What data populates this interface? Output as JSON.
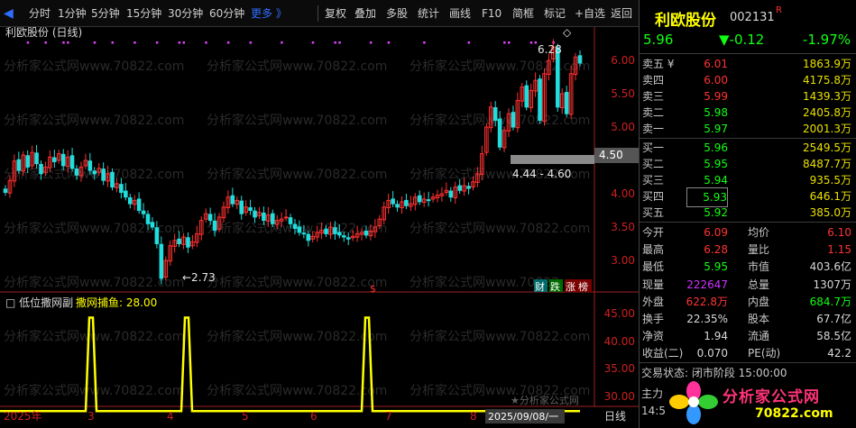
{
  "toolbar": {
    "periods": [
      "分时",
      "1分钟",
      "5分钟",
      "15分钟",
      "30分钟",
      "60分钟"
    ],
    "more": "更多 》",
    "actions": [
      "复权",
      "叠加",
      "多股",
      "统计",
      "画线",
      "F10",
      "简框",
      "标记",
      "+自选",
      "返回"
    ]
  },
  "main_chart": {
    "title": "利欧股份 (日线)",
    "max_label": "6.28",
    "min_label": "←2.73",
    "range_label": "4.44 - 4.60",
    "price_marker": "4.50",
    "y_ticks": [
      "6.00",
      "5.50",
      "5.00",
      "4.50",
      "4.00",
      "3.50",
      "3.00"
    ],
    "badges": [
      "财",
      "跌",
      "涨",
      "榜"
    ],
    "dollar": "$"
  },
  "indicator": {
    "title": "低位撒网副",
    "series_label": "撒网捕鱼: 28.00",
    "y_ticks": [
      "45.00",
      "40.00",
      "35.00",
      "30.00"
    ],
    "watermark": "★分析家公式网"
  },
  "x_axis": {
    "labels": [
      "2025年",
      "3",
      "4",
      "5",
      "6",
      "7",
      "8",
      "2025/09/08/一"
    ],
    "unit": "日线"
  },
  "watermark_text": "分析家公式网www.70822.com",
  "chart_data": [
    {
      "type": "candlestick",
      "title": "利欧股份 (日线)",
      "ylim": [
        2.5,
        6.5
      ],
      "y_ticks": [
        3.0,
        3.5,
        4.0,
        4.5,
        5.0,
        5.5,
        6.0
      ],
      "annotations": {
        "max": 6.28,
        "min": 2.73,
        "range": "4.44 - 4.60",
        "current_marker": 4.5
      },
      "close": [
        4.02,
        4.2,
        4.49,
        4.35,
        4.58,
        4.4,
        4.62,
        4.45,
        4.3,
        4.4,
        4.55,
        4.48,
        4.6,
        4.42,
        4.55,
        4.38,
        4.28,
        4.4,
        4.5,
        4.35,
        4.3,
        4.38,
        4.2,
        4.3,
        4.1,
        4.15,
        4.02,
        3.95,
        3.85,
        3.9,
        3.75,
        3.7,
        3.55,
        3.5,
        3.25,
        2.73,
        3.0,
        3.22,
        3.3,
        3.25,
        3.35,
        3.2,
        3.28,
        3.4,
        3.6,
        3.7,
        3.6,
        3.45,
        3.65,
        3.8,
        3.95,
        3.85,
        3.9,
        3.7,
        3.8,
        3.75,
        3.65,
        3.72,
        3.6,
        3.68,
        3.55,
        3.6,
        3.62,
        3.65,
        3.55,
        3.48,
        3.42,
        3.4,
        3.3,
        3.36,
        3.42,
        3.45,
        3.4,
        3.5,
        3.4,
        3.38,
        3.35,
        3.32,
        3.36,
        3.4,
        3.42,
        3.38,
        3.44,
        3.5,
        3.62,
        3.8,
        3.9,
        3.85,
        3.8,
        3.88,
        3.82,
        3.85,
        3.95,
        3.88,
        3.92,
        3.9,
        3.95,
        3.98,
        4.0,
        4.05,
        3.95,
        4.1,
        4.05,
        4.12,
        4.08,
        4.18,
        4.3,
        4.6,
        5.0,
        5.3,
        5.1,
        4.7,
        4.95,
        5.2,
        5.0,
        5.4,
        5.6,
        5.3,
        5.55,
        5.7,
        5.1,
        5.8,
        6.0,
        6.2,
        5.3,
        5.5,
        5.2,
        5.8,
        6.05,
        5.96
      ],
      "signal_days": [
        13,
        39,
        82
      ]
    },
    {
      "type": "line",
      "title": "低位撒网副",
      "series": [
        {
          "name": "撒网捕鱼",
          "last_value": 28.0,
          "baseline": 28.0,
          "peak": 45.0
        }
      ],
      "ylim": [
        27,
        48
      ],
      "y_ticks": [
        30,
        35,
        40,
        45
      ]
    }
  ],
  "stock": {
    "name": "利欧股份",
    "code": "002131",
    "flag": "R",
    "price": "5.96",
    "change": "▼-0.12",
    "change_pct": "-1.97%"
  },
  "orderbook": {
    "asks": [
      {
        "label": "卖五 ¥",
        "price": "6.01",
        "vol": "1863.9万"
      },
      {
        "label": "卖四",
        "price": "6.00",
        "vol": "4175.8万"
      },
      {
        "label": "卖三",
        "price": "5.99",
        "vol": "1439.3万"
      },
      {
        "label": "卖二",
        "price": "5.98",
        "vol": "2405.8万"
      },
      {
        "label": "卖一",
        "price": "5.97",
        "vol": "2001.3万"
      }
    ],
    "bids": [
      {
        "label": "买一",
        "price": "5.96",
        "vol": "2549.5万"
      },
      {
        "label": "买二",
        "price": "5.95",
        "vol": "8487.7万"
      },
      {
        "label": "买三",
        "price": "5.94",
        "vol": "935.5万"
      },
      {
        "label": "买四",
        "price": "5.93",
        "vol": "646.1万"
      },
      {
        "label": "买五",
        "price": "5.92",
        "vol": "385.0万"
      }
    ]
  },
  "stats": [
    {
      "k1": "今开",
      "v1": "6.09",
      "c1": "#ff3333",
      "k2": "均价",
      "v2": "6.10",
      "c2": "#ff3333"
    },
    {
      "k1": "最高",
      "v1": "6.28",
      "c1": "#ff3333",
      "k2": "量比",
      "v2": "1.15",
      "c2": "#ff3333"
    },
    {
      "k1": "最低",
      "v1": "5.95",
      "c1": "#11ff11",
      "k2": "市值",
      "v2": "403.6亿",
      "c2": "#d8d8d8"
    },
    {
      "k1": "现量",
      "v1": "222647",
      "c1": "#cc33ff",
      "k2": "总量",
      "v2": "1307万",
      "c2": "#d8d8d8"
    },
    {
      "k1": "外盘",
      "v1": "622.8万",
      "c1": "#ff3333",
      "k2": "内盘",
      "v2": "684.7万",
      "c2": "#11ff11"
    },
    {
      "k1": "换手",
      "v1": "22.35%",
      "c1": "#d8d8d8",
      "k2": "股本",
      "v2": "67.7亿",
      "c2": "#d8d8d8"
    },
    {
      "k1": "净资",
      "v1": "1.94",
      "c1": "#d8d8d8",
      "k2": "流通",
      "v2": "58.5亿",
      "c2": "#d8d8d8"
    },
    {
      "k1": "收益(二)",
      "v1": "0.070",
      "c1": "#d8d8d8",
      "k2": "PE(动)",
      "v2": "42.2",
      "c2": "#d8d8d8"
    }
  ],
  "trade_status": "交易状态: 闭市阶段 15:00:00",
  "main_label": "主力",
  "time_label": "14:5",
  "logo": {
    "text": "分析家公式网",
    "url": "70822.com"
  },
  "colors": {
    "up": "#ff3030",
    "down": "#22dddd",
    "ask": "#ff3333",
    "bid": "#11ff11",
    "volume": "#e8e000",
    "signal": "#ffff00",
    "magenta": "#e040ff"
  }
}
